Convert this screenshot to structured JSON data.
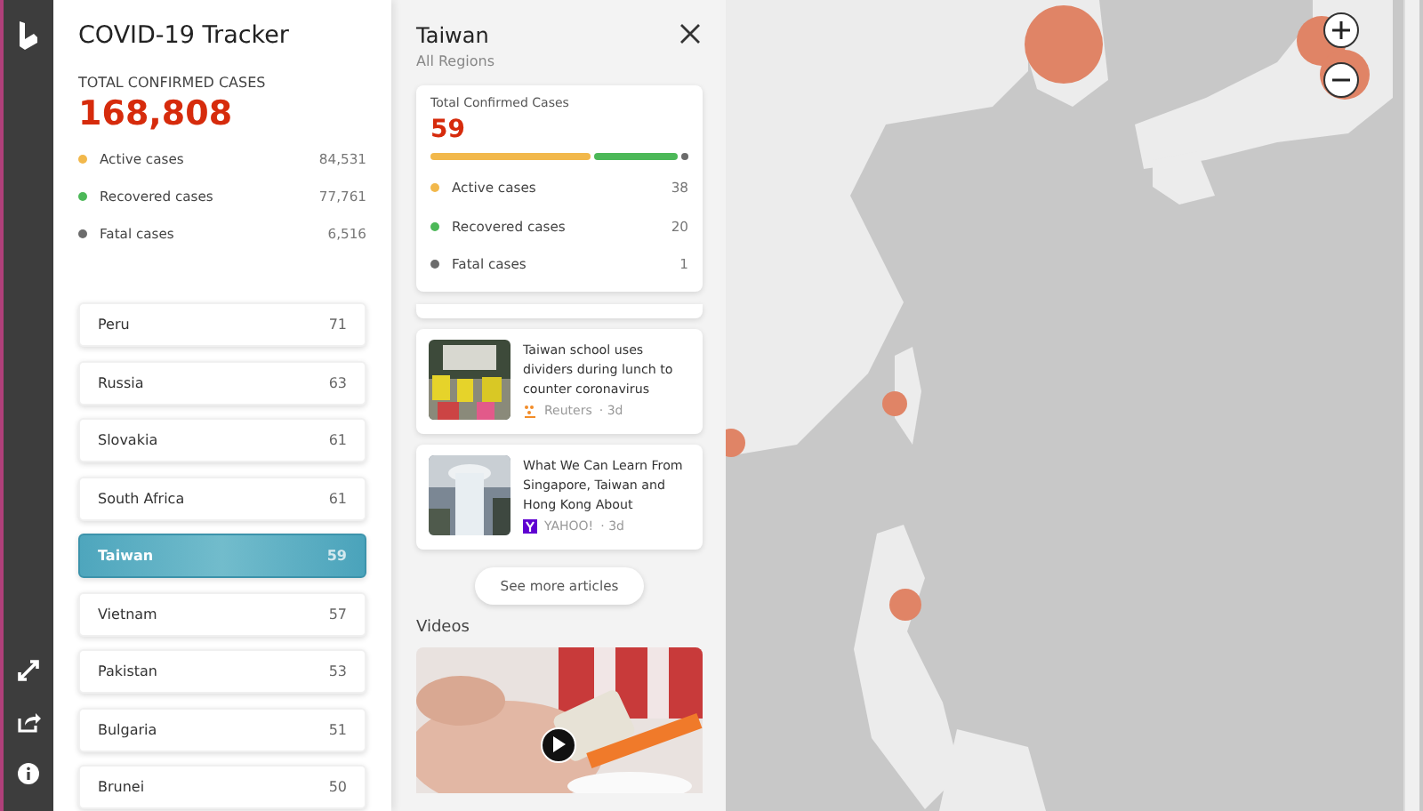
{
  "app": {
    "title": "COVID-19 Tracker"
  },
  "summary": {
    "label": "TOTAL CONFIRMED CASES",
    "total": "168,808",
    "stats": [
      {
        "label": "Active cases",
        "value": "84,531",
        "color": "#f2b84b"
      },
      {
        "label": "Recovered cases",
        "value": "77,761",
        "color": "#4cb858"
      },
      {
        "label": "Fatal cases",
        "value": "6,516",
        "color": "#6b6b6b"
      }
    ]
  },
  "countries": [
    {
      "name": "Peru",
      "count": "71",
      "selected": false
    },
    {
      "name": "Russia",
      "count": "63",
      "selected": false
    },
    {
      "name": "Slovakia",
      "count": "61",
      "selected": false
    },
    {
      "name": "South Africa",
      "count": "61",
      "selected": false
    },
    {
      "name": "Taiwan",
      "count": "59",
      "selected": true
    },
    {
      "name": "Vietnam",
      "count": "57",
      "selected": false
    },
    {
      "name": "Pakistan",
      "count": "53",
      "selected": false
    },
    {
      "name": "Bulgaria",
      "count": "51",
      "selected": false
    },
    {
      "name": "Brunei",
      "count": "50",
      "selected": false
    }
  ],
  "detail": {
    "title": "Taiwan",
    "subtitle": "All Regions",
    "card": {
      "label": "Total Confirmed Cases",
      "total": "59",
      "stats": [
        {
          "label": "Active cases",
          "value": "38",
          "color": "#f2b84b"
        },
        {
          "label": "Recovered cases",
          "value": "20",
          "color": "#4cb858"
        },
        {
          "label": "Fatal cases",
          "value": "1",
          "color": "#6b6b6b"
        }
      ]
    },
    "articles": [
      {
        "headline": "Taiwan school uses dividers during lunch to counter coronavirus",
        "source": "Reuters",
        "age": "· 3d",
        "kind": "reuters"
      },
      {
        "headline": "What We Can Learn From Singapore, Taiwan and Hong Kong About",
        "source": "YAHOO!",
        "age": "· 3d",
        "kind": "yahoo"
      }
    ],
    "more_button": "See more articles",
    "videos_heading": "Videos"
  }
}
